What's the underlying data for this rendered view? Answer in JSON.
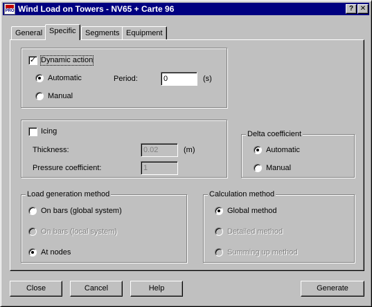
{
  "window": {
    "title": "Wind Load on Towers - NV65 + Carte 96",
    "app_icon_text": "PRO",
    "help_glyph": "?",
    "close_glyph": "✕"
  },
  "tabs": [
    {
      "label": "General",
      "active": false
    },
    {
      "label": "Specific",
      "active": true
    },
    {
      "label": "Segments",
      "active": false
    },
    {
      "label": "Equipment",
      "active": false
    }
  ],
  "dynamic": {
    "checkbox_label": "Dynamic action",
    "checked": true,
    "automatic_label": "Automatic",
    "manual_label": "Manual",
    "selected": "Automatic",
    "period_label": "Period:",
    "period_value": "0",
    "period_unit": "(s)"
  },
  "icing": {
    "checkbox_label": "Icing",
    "checked": false,
    "thickness_label": "Thickness:",
    "thickness_value": "0.02",
    "thickness_unit": "(m)",
    "pressure_label": "Pressure coefficient:",
    "pressure_value": "1"
  },
  "delta": {
    "title": "Delta coefficient",
    "automatic_label": "Automatic",
    "manual_label": "Manual",
    "selected": "Automatic"
  },
  "load_generation": {
    "title": "Load generation method",
    "option_bars_global": "On bars (global system)",
    "option_bars_local": "On bars (local system)",
    "option_nodes": "At nodes",
    "selected": "At nodes"
  },
  "calculation": {
    "title": "Calculation method",
    "option_global": "Global method",
    "option_detailed": "Detailed method",
    "option_summing": "Summing up method",
    "selected": "Global method"
  },
  "buttons": {
    "close": "Close",
    "cancel": "Cancel",
    "help": "Help",
    "generate": "Generate"
  },
  "colors": {
    "dialog_bg": "#c0c0c0",
    "titlebar": "#000080",
    "disabled_text": "#808080"
  }
}
